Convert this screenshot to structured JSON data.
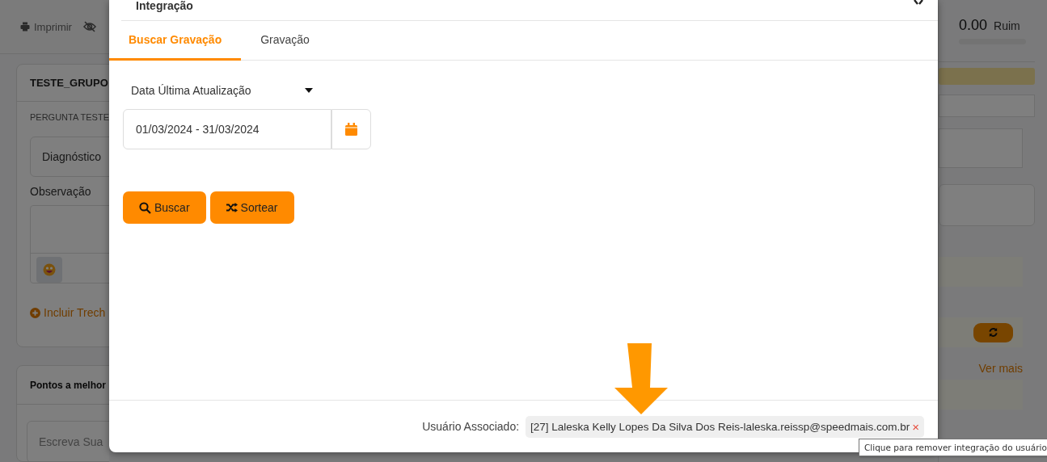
{
  "background_page": {
    "toolbar": {
      "print_label": "Imprimir"
    },
    "card": {
      "title": "TESTE_GRUPO",
      "question": "PERGUNTA TESTE",
      "select_value": "Diagnóstico",
      "observation_label": "Observação",
      "add_link": "Incluir Trech"
    },
    "card_2": {
      "title": "Pontos a melhor",
      "placeholder": "Escreva Sua"
    },
    "score": {
      "value": "0.00",
      "rating": "Ruim",
      "level": 0
    },
    "see_more": "Ver mais"
  },
  "modal": {
    "title": "Integração",
    "tabs": [
      {
        "label": "Buscar Gravação",
        "selected": true
      },
      {
        "label": "Gravação",
        "selected": false
      }
    ],
    "date_filter": {
      "label": "Data Última Atualização"
    },
    "date_range": "01/03/2024 - 31/03/2024",
    "buttons": [
      {
        "label": "Buscar",
        "kind": "search"
      },
      {
        "label": "Sortear",
        "kind": "shuffle"
      }
    ],
    "footer": {
      "label": "Usuário Associado:",
      "user_tag": "[27] Laleska Kelly Lopes Da Silva Dos Reis-laleska.reissp@speedmais.com.br",
      "remove": "×"
    }
  },
  "tooltip": "Clique para remover integração do usuário"
}
